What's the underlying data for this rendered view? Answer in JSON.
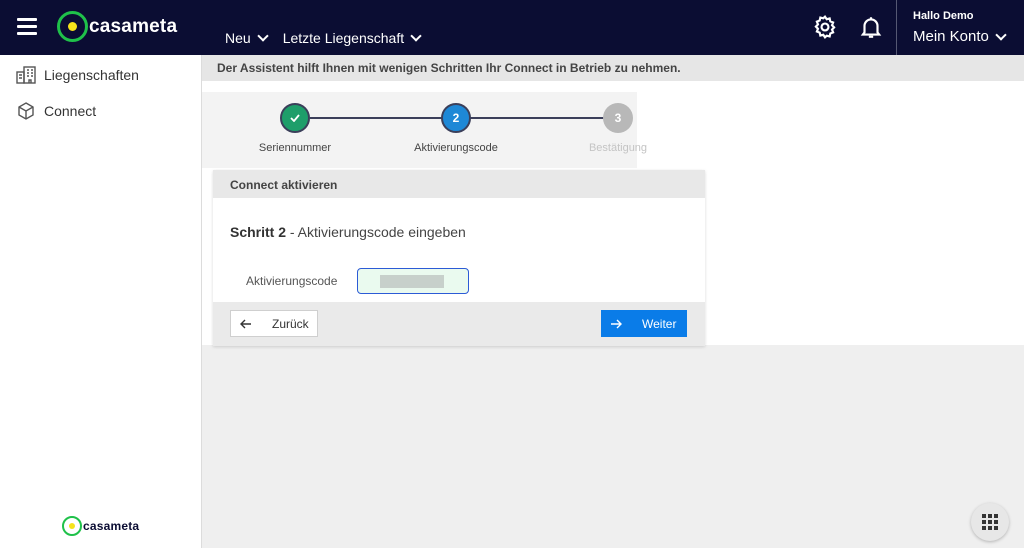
{
  "header": {
    "logo_text": "casameta",
    "nav": [
      {
        "label": "Neu"
      },
      {
        "label": "Letzte Liegenschaft"
      }
    ],
    "greeting": "Hallo Demo",
    "account_label": "Mein Konto"
  },
  "sidebar": {
    "items": [
      {
        "label": "Liegenschaften",
        "icon": "buildings-icon"
      },
      {
        "label": "Connect",
        "icon": "cube-icon"
      }
    ],
    "logo_text": "casameta"
  },
  "infobar": {
    "text": "Der Assistent hilft Ihnen mit wenigen Schritten Ihr Connect in Betrieb zu nehmen."
  },
  "stepper": {
    "steps": [
      {
        "number": "",
        "label": "Seriennummer",
        "state": "done"
      },
      {
        "number": "2",
        "label": "Aktivierungscode",
        "state": "active"
      },
      {
        "number": "3",
        "label": "Bestätigung",
        "state": "pending"
      }
    ]
  },
  "card": {
    "header": "Connect aktivieren",
    "title_bold": "Schritt 2",
    "title_rest": " - Aktivierungscode eingeben",
    "field_label": "Aktivierungscode",
    "field_value": "",
    "back_label": "Zurück",
    "next_label": "Weiter"
  },
  "colors": {
    "header_bg": "#0b0d33",
    "brand_green": "#1fc14a",
    "brand_yellow": "#f6e31b",
    "step_done": "#1e9e6a",
    "step_active": "#1e88d6",
    "step_pending": "#b8b8b8",
    "primary_button": "#0a7ce8"
  }
}
